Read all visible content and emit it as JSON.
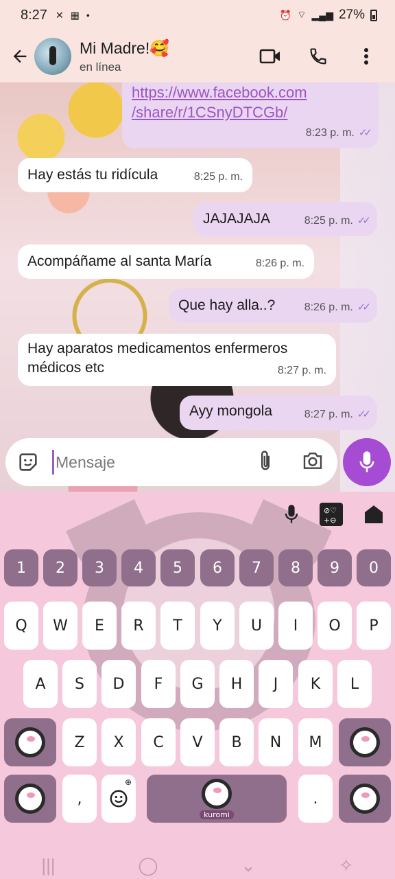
{
  "status": {
    "time": "8:27",
    "battery": "27%"
  },
  "header": {
    "name": "Mi Madre!🥰",
    "status": "en línea"
  },
  "messages": [
    {
      "dir": "out",
      "text": "https://www.facebook.com\n/share/r/1CSnyDTCGb/",
      "time": "8:23 p. m."
    },
    {
      "dir": "in",
      "text": "Hay estás tu ridícula",
      "time": "8:25 p. m."
    },
    {
      "dir": "out",
      "text": "JAJAJAJA",
      "time": "8:25 p. m."
    },
    {
      "dir": "in",
      "text": "Acompáñame al santa María",
      "time": "8:26 p. m."
    },
    {
      "dir": "out",
      "text": "Que hay alla..?",
      "time": "8:26 p. m."
    },
    {
      "dir": "in",
      "text": "Hay aparatos medicamentos enfermeros médicos etc",
      "time": "8:27 p. m."
    },
    {
      "dir": "out",
      "text": "Ayy mongola",
      "time": "8:27 p. m."
    }
  ],
  "composer": {
    "placeholder": "Mensaje"
  },
  "keyboard": {
    "numbers": [
      "1",
      "2",
      "3",
      "4",
      "5",
      "6",
      "7",
      "8",
      "9",
      "0"
    ],
    "row1": [
      "Q",
      "W",
      "E",
      "R",
      "T",
      "Y",
      "U",
      "I",
      "O",
      "P"
    ],
    "row2": [
      "A",
      "S",
      "D",
      "F",
      "G",
      "H",
      "J",
      "K",
      "L"
    ],
    "row3": [
      "Z",
      "X",
      "C",
      "V",
      "B",
      "N",
      "M"
    ],
    "comma": ",",
    "period": ".",
    "space_label": "kuromi"
  },
  "colors": {
    "accent": "#a64bd3",
    "outgoing": "#ebd6f1",
    "incoming": "#ffffff",
    "keyboard_bg": "#f5c8dc",
    "key_dark": "#8f6f8b"
  }
}
